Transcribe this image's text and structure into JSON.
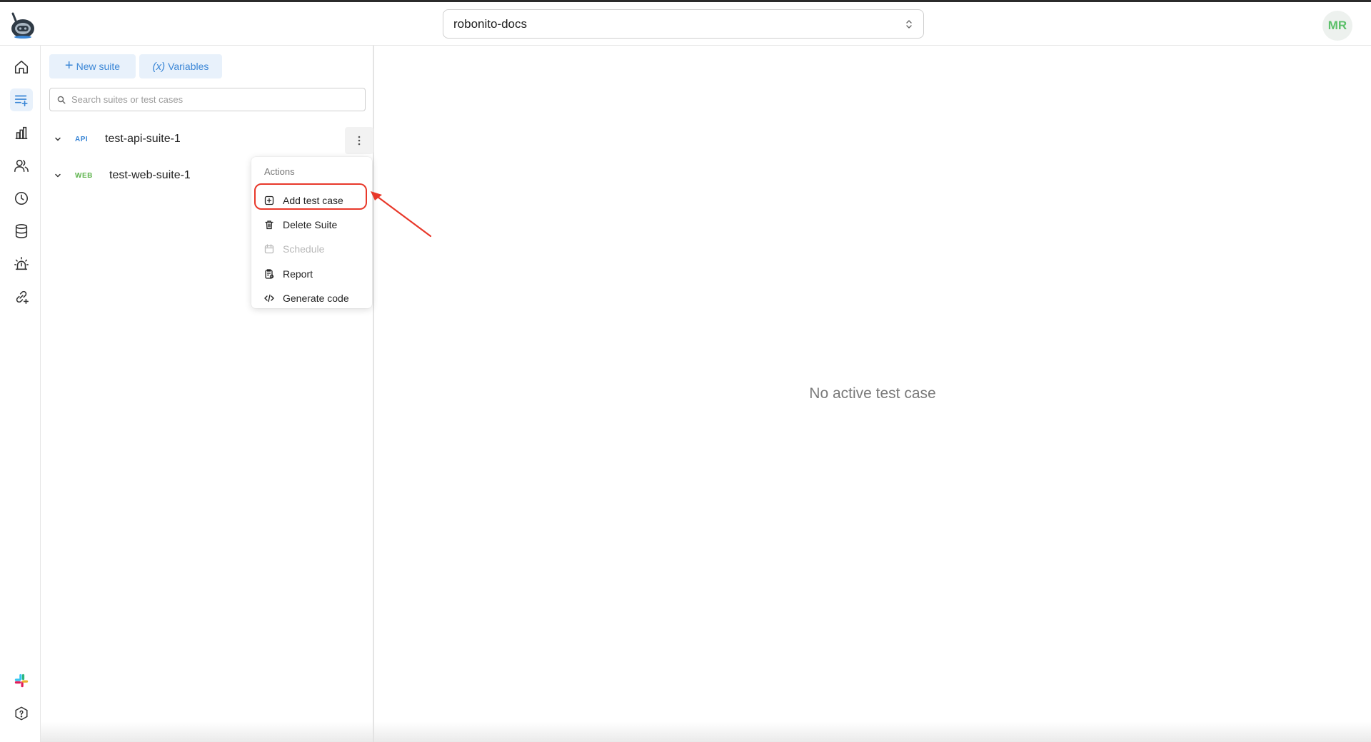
{
  "header": {
    "project_name": "robonito-docs",
    "avatar_initials": "MR"
  },
  "rail": {
    "items": [
      {
        "icon": "home-icon"
      },
      {
        "icon": "test-suites-icon",
        "active": true
      },
      {
        "icon": "bar-chart-icon"
      },
      {
        "icon": "users-icon"
      },
      {
        "icon": "clock-icon"
      },
      {
        "icon": "database-icon"
      },
      {
        "icon": "alarm-icon"
      },
      {
        "icon": "link-add-icon"
      }
    ],
    "bottom_items": [
      {
        "icon": "slack-icon"
      },
      {
        "icon": "help-icon"
      }
    ]
  },
  "toolbar": {
    "new_suite_label": "New suite",
    "variables_label": "Variables",
    "variables_symbol": "(x)"
  },
  "search": {
    "placeholder": "Search suites or test cases",
    "value": ""
  },
  "suites": [
    {
      "tag": "API",
      "name": "test-api-suite-1"
    },
    {
      "tag": "WEB",
      "name": "test-web-suite-1"
    }
  ],
  "menu": {
    "title": "Actions",
    "items": [
      {
        "label": "Add test case",
        "icon": "add-square-icon"
      },
      {
        "label": "Delete Suite",
        "icon": "trash-icon"
      },
      {
        "label": "Schedule",
        "icon": "calendar-icon",
        "disabled": true
      },
      {
        "label": "Report",
        "icon": "report-icon"
      },
      {
        "label": "Generate code",
        "icon": "code-icon"
      }
    ]
  },
  "main": {
    "empty_message": "No active test case"
  },
  "colors": {
    "accent_blue": "#3a86d6",
    "web_green": "#5fb44e",
    "annotation_red": "#e8382a",
    "avatar_green": "#5cc06a"
  }
}
